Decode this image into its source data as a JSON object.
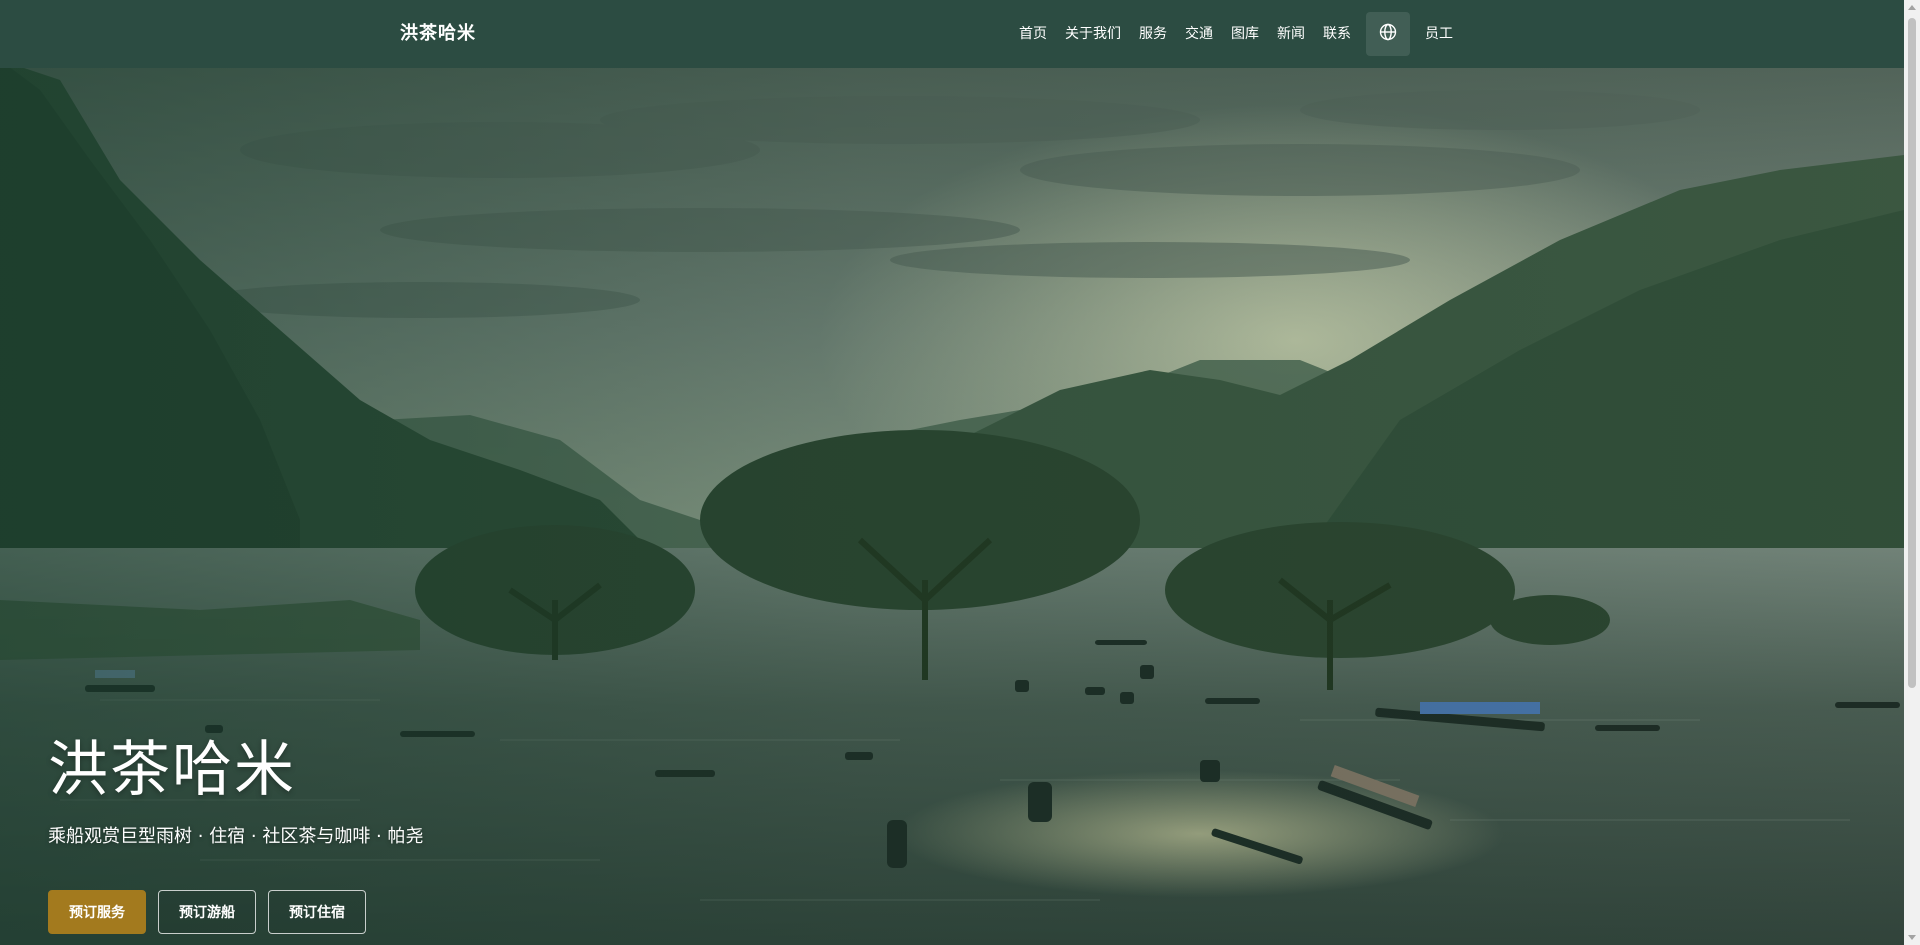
{
  "header": {
    "brand": "洪茶哈米",
    "nav": [
      "首页",
      "关于我们",
      "服务",
      "交通",
      "图库",
      "新闻",
      "联系"
    ],
    "language_icon": "globe-icon",
    "staff_link": "员工"
  },
  "hero": {
    "title": "洪茶哈米",
    "subtitle": "乘船观赏巨型雨树 · 住宿 · 社区茶与咖啡 · 帕尧",
    "buttons": {
      "book_service": "预订服务",
      "book_boat": "预订游船",
      "book_stay": "预订住宿"
    }
  },
  "colors": {
    "header_bg": "#2c4c42",
    "primary_button": "#a37a1e",
    "text": "#ffffff"
  }
}
